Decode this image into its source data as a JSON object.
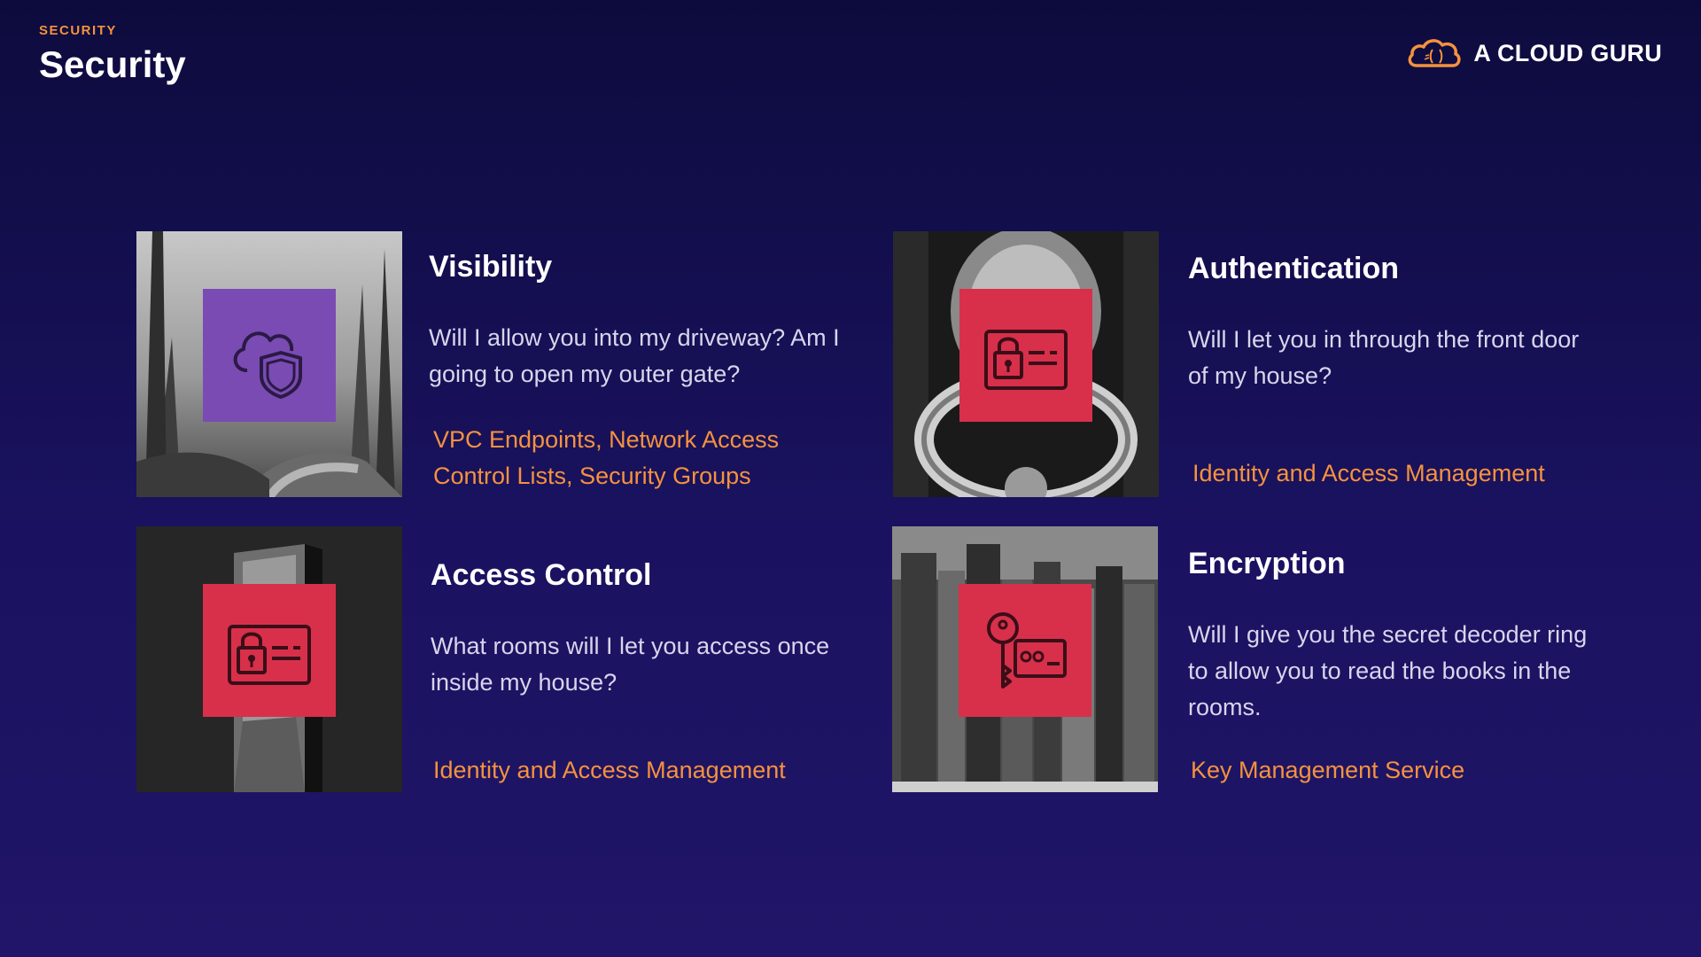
{
  "header": {
    "eyebrow": "SECURITY",
    "title": "Security"
  },
  "brand": {
    "name": "A CLOUD GURU",
    "logo_icon": "cloud-logo-icon",
    "accent": "#f5923e"
  },
  "colors": {
    "accent": "#f5923e",
    "tile_purple": "#7a4bb3",
    "tile_red": "#d8304a",
    "background": "#120d4f"
  },
  "cards": [
    {
      "title": "Visibility",
      "description": "Will I allow you into my driveway? Am I going to open my outer gate?",
      "services": "VPC Endpoints, Network Access Control Lists, Security Groups",
      "icon": "cloud-shield-icon",
      "image": "foggy-driveway-photo"
    },
    {
      "title": "Authentication",
      "description": "Will I let you in through the front door of my house?",
      "services": "Identity and Access Management",
      "icon": "id-card-lock-icon",
      "image": "door-knocker-photo"
    },
    {
      "title": "Access Control",
      "description": "What rooms will I let you access once inside my house?",
      "services": "Identity and Access Management",
      "icon": "id-card-lock-icon",
      "image": "open-doorway-photo"
    },
    {
      "title": "Encryption",
      "description": "Will I give you the secret decoder ring to allow you to read the books in the rooms.",
      "services": "Key Management Service",
      "icon": "key-card-icon",
      "image": "old-books-photo"
    }
  ]
}
